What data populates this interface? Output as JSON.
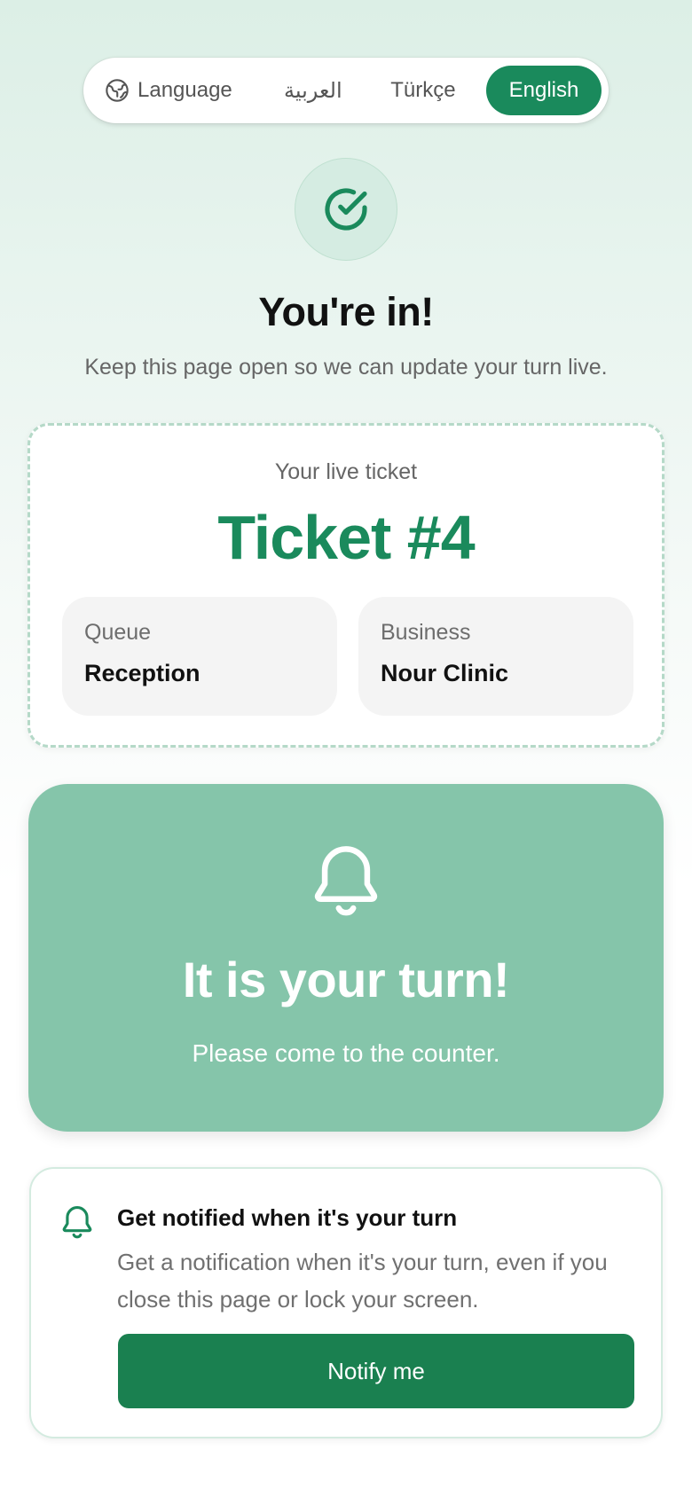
{
  "language_bar": {
    "label": "Language",
    "options": [
      {
        "label": "العربية",
        "selected": false
      },
      {
        "label": "Türkçe",
        "selected": false
      },
      {
        "label": "English",
        "selected": true
      }
    ]
  },
  "header": {
    "title": "You're in!",
    "subtitle": "Keep this page open so we can update your turn live."
  },
  "ticket": {
    "caption": "Your live ticket",
    "number": "Ticket #4",
    "queue_label": "Queue",
    "queue_value": "Reception",
    "business_label": "Business",
    "business_value": "Nour Clinic"
  },
  "turn": {
    "title": "It is your turn!",
    "subtitle": "Please come to the counter."
  },
  "notify": {
    "title": "Get notified when it's your turn",
    "description": "Get a notification when it's your turn, even if you close this page or lock your screen.",
    "button_label": "Notify me"
  },
  "icons": {
    "language": "globe-icon",
    "success": "check-circle-icon",
    "turn": "bell-icon",
    "notify": "bell-icon"
  },
  "colors": {
    "accent": "#1a8a5c",
    "button": "#1a8050",
    "turn_card": "#85c5aa",
    "ticket_border": "#b5d9c8"
  }
}
